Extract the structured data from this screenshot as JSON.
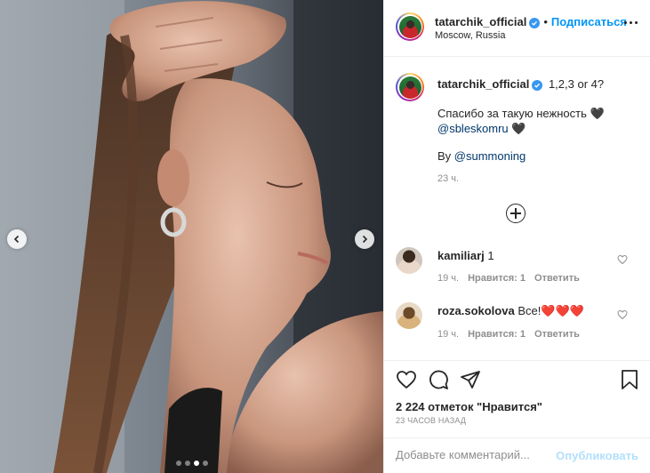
{
  "post": {
    "author": "tatarchik_official",
    "follow_label": "Подписаться",
    "location": "Moscow, Russia",
    "caption_text": "1,2,3 or 4?",
    "caption_line2": "Спасибо за такую нежность 🖤",
    "caption_mention1": "@sbleskomru",
    "caption_line3_suffix": " 🖤",
    "caption_by": "By ",
    "caption_mention2": "@summoning",
    "caption_time": "23 ч.",
    "likes": "2 224 отметок \"Нравится\"",
    "time_ago": "23 ЧАСОВ НАЗАД",
    "comment_placeholder": "Добавьте комментарий...",
    "post_label": "Опубликовать",
    "carousel": {
      "count": 4,
      "active": 2
    }
  },
  "comments": [
    {
      "user": "kamiliarj",
      "text": " 1",
      "time": "19 ч.",
      "likes": "Нравится: 1",
      "reply": "Ответить"
    },
    {
      "user": "roza.sokolova",
      "text": " Все!",
      "hearts": "❤️❤️❤️",
      "time": "19 ч.",
      "likes": "Нравится: 1",
      "reply": "Ответить"
    }
  ],
  "icons": {
    "verified": "verified-badge-icon",
    "more": "more-options-icon",
    "like": "heart-icon",
    "comment": "comment-icon",
    "share": "paper-plane-icon",
    "save": "bookmark-icon",
    "load_more": "plus-circle-icon",
    "prev": "chevron-left-icon",
    "next": "chevron-right-icon"
  },
  "colors": {
    "link": "#0095f6",
    "mention": "#00376b",
    "muted": "#8e8e8e",
    "verified": "#3897f0",
    "post_disabled": "#b2dffc"
  }
}
